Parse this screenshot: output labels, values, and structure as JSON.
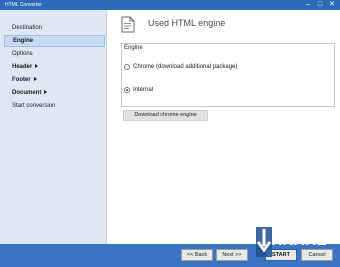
{
  "window": {
    "title": "HTML Converter",
    "minimize_glyph": "–",
    "maximize_glyph": "□",
    "close_glyph": "✕"
  },
  "sidebar": {
    "items": [
      {
        "label": "Destination",
        "active": false,
        "has_arrow": false
      },
      {
        "label": "Engine",
        "active": true,
        "has_arrow": false
      },
      {
        "label": "Options",
        "active": false,
        "has_arrow": false
      },
      {
        "label": "Header",
        "active": false,
        "has_arrow": true
      },
      {
        "label": "Footer",
        "active": false,
        "has_arrow": true
      },
      {
        "label": "Document",
        "active": false,
        "has_arrow": true
      },
      {
        "label": "Start conversion",
        "active": false,
        "has_arrow": false
      }
    ]
  },
  "main": {
    "page_icon": "document-icon",
    "page_title": "Used HTML engine",
    "group_label": "Engine",
    "options": [
      {
        "label": "Chrome (download additional package)",
        "checked": false
      },
      {
        "label": "Internal",
        "checked": true
      }
    ],
    "download_button": "Download chrome engine"
  },
  "footer": {
    "back_label": "<< Back",
    "next_label": "Next >>",
    "start_label": "START",
    "cancel_label": "Cancel"
  },
  "watermark": {
    "text": "XKARE"
  },
  "colors": {
    "titlebar": "#2d6ab8",
    "sidebar_bg": "#dde8f4",
    "active_item": "#c6daf2",
    "footer_bg": "#3a74c2"
  }
}
